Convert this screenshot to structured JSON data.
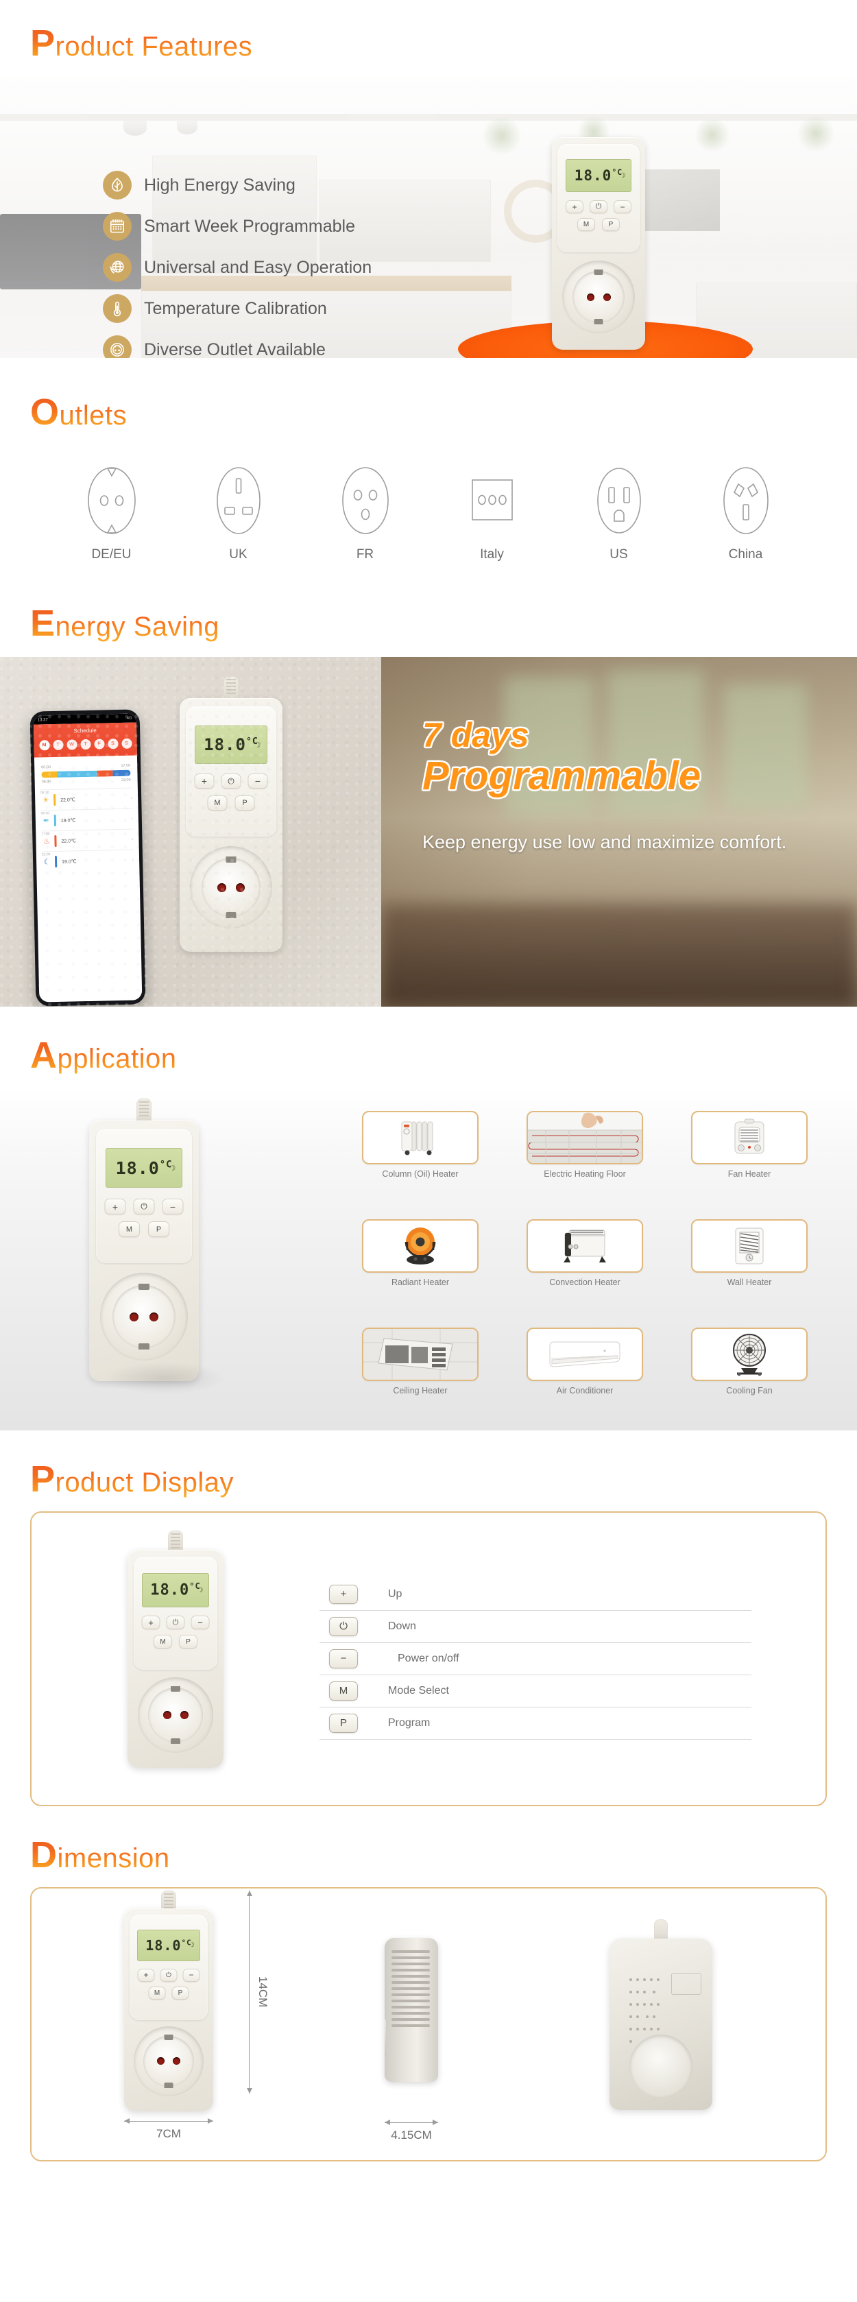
{
  "sections": {
    "features": {
      "cap": "P",
      "rest": "roduct Features"
    },
    "outlets": {
      "cap": "O",
      "rest": "utlets"
    },
    "energy": {
      "cap": "E",
      "rest": "nergy Saving"
    },
    "application": {
      "cap": "A",
      "rest": "pplication"
    },
    "display": {
      "cap": "P",
      "rest": "roduct Display"
    },
    "dimension": {
      "cap": "D",
      "rest": "imension"
    }
  },
  "features": {
    "items": [
      {
        "label": "High Energy Saving",
        "icon": "leaf-icon"
      },
      {
        "label": "Smart Week Programmable",
        "icon": "calendar-icon"
      },
      {
        "label": "Universal and Easy Operation",
        "icon": "globe-refresh-icon"
      },
      {
        "label": "Temperature Calibration",
        "icon": "thermometer-icon"
      },
      {
        "label": "Diverse Outlet Available",
        "icon": "outlet-icon"
      }
    ]
  },
  "device": {
    "display_value": "18.0",
    "display_unit": "C",
    "buttons": [
      "+",
      "⏻",
      "−"
    ],
    "mode_button": "M",
    "program_button": "P"
  },
  "outlets": {
    "items": [
      {
        "label": "DE/EU",
        "icon": "outlet-de-eu-icon"
      },
      {
        "label": "UK",
        "icon": "outlet-uk-icon"
      },
      {
        "label": "FR",
        "icon": "outlet-fr-icon"
      },
      {
        "label": "Italy",
        "icon": "outlet-italy-icon"
      },
      {
        "label": "US",
        "icon": "outlet-us-icon"
      },
      {
        "label": "China",
        "icon": "outlet-china-icon"
      }
    ]
  },
  "energy": {
    "headline_line1": "7 days",
    "headline_line2": "Programmable",
    "subtext": "Keep energy use low and maximize comfort.",
    "phone": {
      "status_time": "13:37",
      "status_right": "4G",
      "title": "Schedule",
      "days": [
        "M",
        "T",
        "W",
        "T",
        "F",
        "S",
        "S"
      ],
      "active_day": "M",
      "timeline_top_left": "00:00",
      "timeline_top_right": "17:00",
      "timeline_bot_left": "06:30",
      "timeline_bot_right": "22:00",
      "segments": [
        {
          "color": "#f7b824",
          "width": 18
        },
        {
          "color": "#5bc0e8",
          "width": 44
        },
        {
          "color": "#ef5a31",
          "width": 18
        },
        {
          "color": "#3c7fd0",
          "width": 20
        }
      ],
      "rows": [
        {
          "time": "06:30",
          "icon": "☀",
          "icon_color": "#f7b824",
          "bar": "#f7b824",
          "temp": "22.0℃"
        },
        {
          "time": "08:30",
          "icon": "✒",
          "icon_color": "#5bc0e8",
          "bar": "#5bc0e8",
          "temp": "19.0℃"
        },
        {
          "time": "17:00",
          "icon": "♨",
          "icon_color": "#ef5a31",
          "bar": "#ef5a31",
          "temp": "22.0℃"
        },
        {
          "time": "22:00",
          "icon": "☾",
          "icon_color": "#3c7fd0",
          "bar": "#3c7fd0",
          "temp": "19.0℃"
        }
      ]
    }
  },
  "application": {
    "items": [
      {
        "label": "Column (Oil) Heater",
        "icon": "oil-heater-icon"
      },
      {
        "label": "Electric Heating Floor",
        "icon": "heating-floor-icon"
      },
      {
        "label": "Fan Heater",
        "icon": "fan-heater-icon"
      },
      {
        "label": "Radiant Heater",
        "icon": "radiant-heater-icon"
      },
      {
        "label": "Convection Heater",
        "icon": "convection-heater-icon"
      },
      {
        "label": "Wall Heater",
        "icon": "wall-heater-icon"
      },
      {
        "label": "Ceiling Heater",
        "icon": "ceiling-heater-icon"
      },
      {
        "label": "Air Conditioner",
        "icon": "air-conditioner-icon"
      },
      {
        "label": "Cooling Fan",
        "icon": "cooling-fan-icon"
      }
    ]
  },
  "product_display": {
    "rows": [
      {
        "key": "+",
        "label": "Up"
      },
      {
        "key": "⏻",
        "label": "Down"
      },
      {
        "key": "−",
        "label": "Power on/off"
      },
      {
        "key": "M",
        "label": "Mode Select"
      },
      {
        "key": "P",
        "label": "Program"
      }
    ]
  },
  "dimension": {
    "height": "14CM",
    "width": "7CM",
    "depth": "4.15CM"
  },
  "colors": {
    "accent_orange": "#f47521",
    "accent_deep": "#ef5a1e",
    "icon_gold": "#cda862",
    "panel_border": "#e3bd84",
    "text_gray": "#6b6b6b"
  }
}
